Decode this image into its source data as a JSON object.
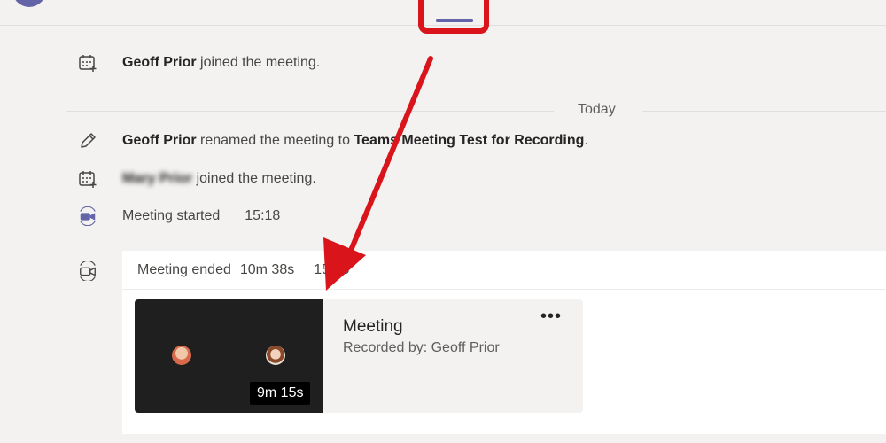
{
  "header": {
    "active_tab_indicator": "highlighted"
  },
  "feed": {
    "items": [
      {
        "icon": "calendar-add-icon",
        "actor": "Geoff Prior",
        "action": "joined the meeting."
      },
      {
        "icon": "pencil-icon",
        "actor": "Geoff Prior",
        "action": "renamed the meeting to",
        "target": "Teams Meeting Test for Recording",
        "suffix": "."
      },
      {
        "icon": "calendar-add-icon",
        "actor": "Mary Prior",
        "action": "joined the meeting."
      },
      {
        "icon": "video-camera-icon",
        "text": "Meeting started",
        "time": "15:18"
      }
    ],
    "date_divider": "Today"
  },
  "meeting_card": {
    "icon": "video-camera-outline-icon",
    "status": "Meeting ended",
    "duration": "10m 38s",
    "end_time": "15:28",
    "recording": {
      "title": "Meeting",
      "recorded_by": "Recorded by: Geoff Prior",
      "length": "9m 15s",
      "more_label": "•••"
    }
  },
  "colors": {
    "accent": "#6264a7",
    "highlight": "#d9151b",
    "background": "#f3f2f1"
  }
}
